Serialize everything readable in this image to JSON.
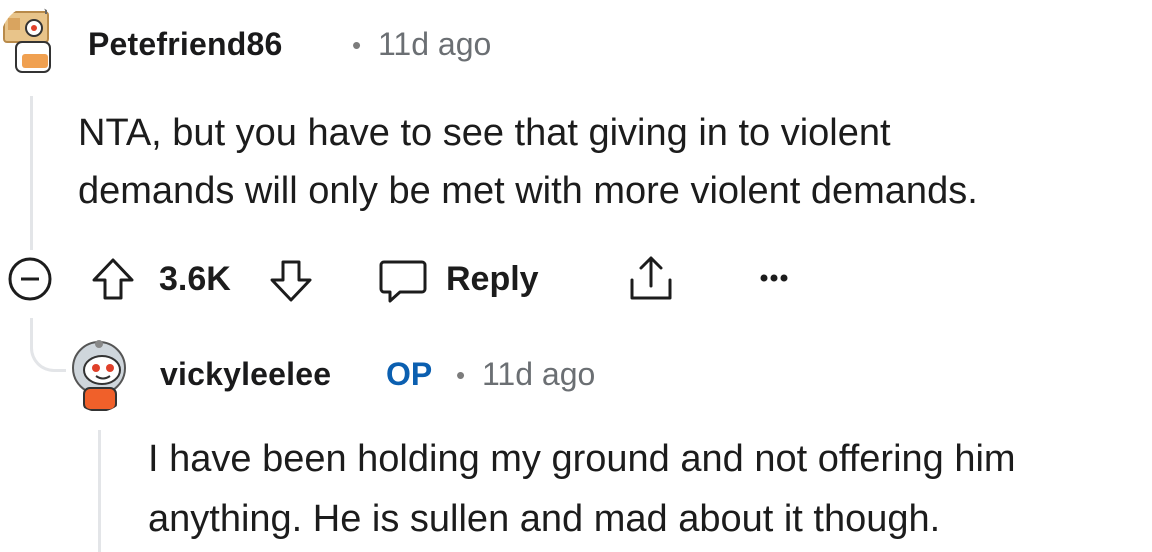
{
  "comments": [
    {
      "username": "Petefriend86",
      "time": "11d ago",
      "body_lines": [
        "NTA, but you have to see that giving in to violent",
        "demands will only be met with more violent demands."
      ],
      "votes": "3.6K",
      "reply_label": "Reply",
      "avatar_icon": "snoo-box-avatar-icon"
    },
    {
      "username": "vickyleelee",
      "badge": "OP",
      "time": "11d ago",
      "body_lines": [
        "I have been holding my ground and not offering him",
        "anything. He is sullen and mad about it though."
      ],
      "avatar_icon": "snoo-astronaut-avatar-icon"
    }
  ],
  "separator": "•",
  "colors": {
    "op_badge": "#0b5fb0",
    "meta_text": "#6b6f73",
    "thread_line": "#e3e5e8",
    "orange": "#f0602a"
  }
}
